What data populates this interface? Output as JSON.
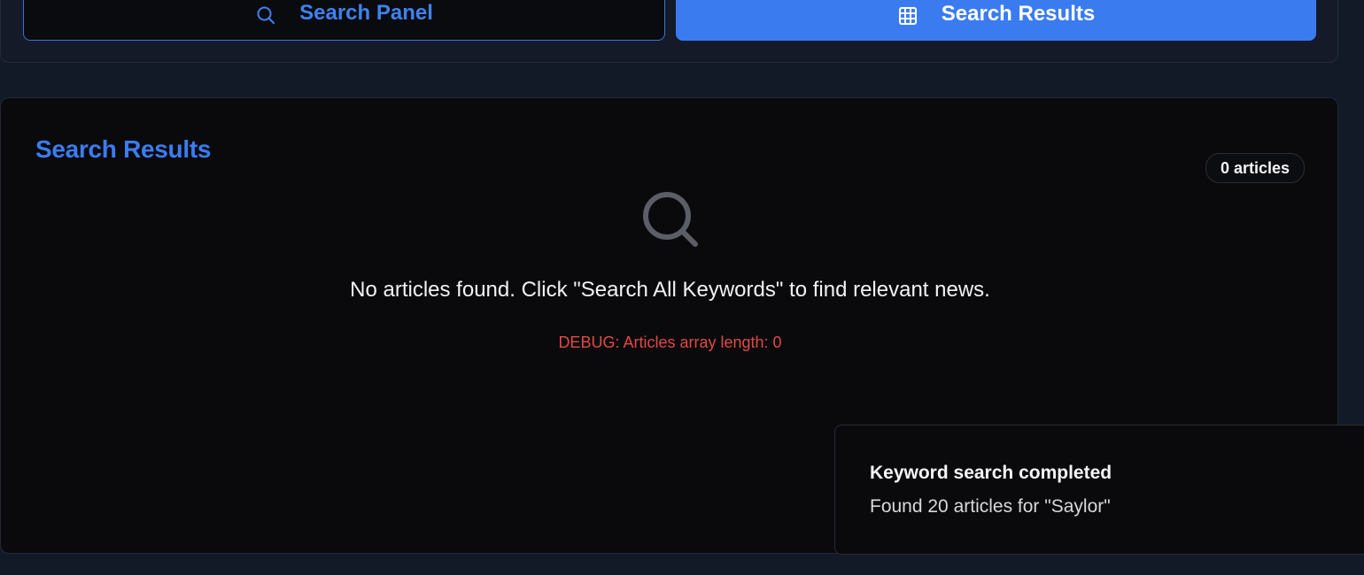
{
  "tabs": {
    "search_panel": {
      "label": "Search Panel",
      "icon": "search-icon"
    },
    "search_results": {
      "label": "Search Results",
      "icon": "grid-icon"
    }
  },
  "results": {
    "title": "Search Results",
    "count_badge": "0 articles",
    "empty_icon": "search-icon",
    "empty_message": "No articles found. Click \"Search All Keywords\" to find relevant news.",
    "debug": "DEBUG: Articles array length: 0"
  },
  "toast": {
    "title": "Keyword search completed",
    "description": "Found 20 articles for \"Saylor\""
  },
  "colors": {
    "accent": "#3a7cf0",
    "background": "#131a27",
    "card": "#0a0a0d",
    "debug": "#e04a44"
  }
}
